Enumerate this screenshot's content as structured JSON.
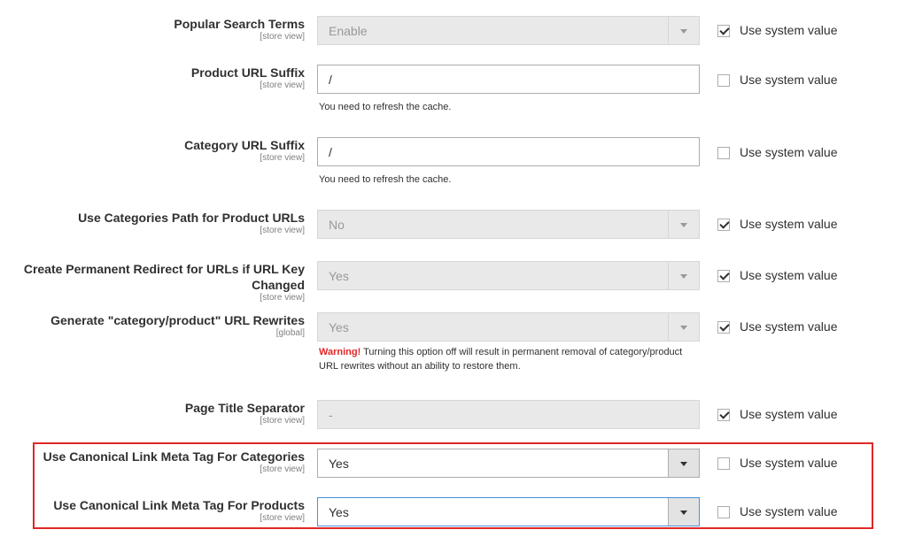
{
  "rows": [
    {
      "label": "Popular Search Terms",
      "scope": "[store view]",
      "value": "Enable",
      "checked": true,
      "note": ""
    },
    {
      "label": "Product URL Suffix",
      "scope": "[store view]",
      "value": "/",
      "checked": false,
      "note": "You need to refresh the cache."
    },
    {
      "label": "Category URL Suffix",
      "scope": "[store view]",
      "value": "/",
      "checked": false,
      "note": "You need to refresh the cache."
    },
    {
      "label": "Use Categories Path for Product URLs",
      "scope": "[store view]",
      "value": "No",
      "checked": true,
      "note": ""
    },
    {
      "label_line1": "Create Permanent Redirect for URLs if URL Key",
      "label_line2": "Changed",
      "scope": "[store view]",
      "value": "Yes",
      "checked": true,
      "note": ""
    },
    {
      "label": "Generate \"category/product\" URL Rewrites",
      "scope": "[global]",
      "value": "Yes",
      "checked": true,
      "note_warn": "Warning!",
      "note_rest": " Turning this option off will result in permanent removal of category/product URL rewrites without an ability to restore them."
    },
    {
      "label": "Page Title Separator",
      "scope": "[store view]",
      "value": "-",
      "checked": true,
      "note": ""
    },
    {
      "label": "Use Canonical Link Meta Tag For Categories",
      "scope": "[store view]",
      "value": "Yes",
      "checked": false,
      "note": ""
    },
    {
      "label": "Use Canonical Link Meta Tag For Products",
      "scope": "[store view]",
      "value": "Yes",
      "checked": false,
      "note": ""
    }
  ],
  "use_system_value_label": "Use system value",
  "colors": {
    "warning": "#e22626",
    "highlight": "#e22626",
    "focus": "#4a90d9"
  }
}
